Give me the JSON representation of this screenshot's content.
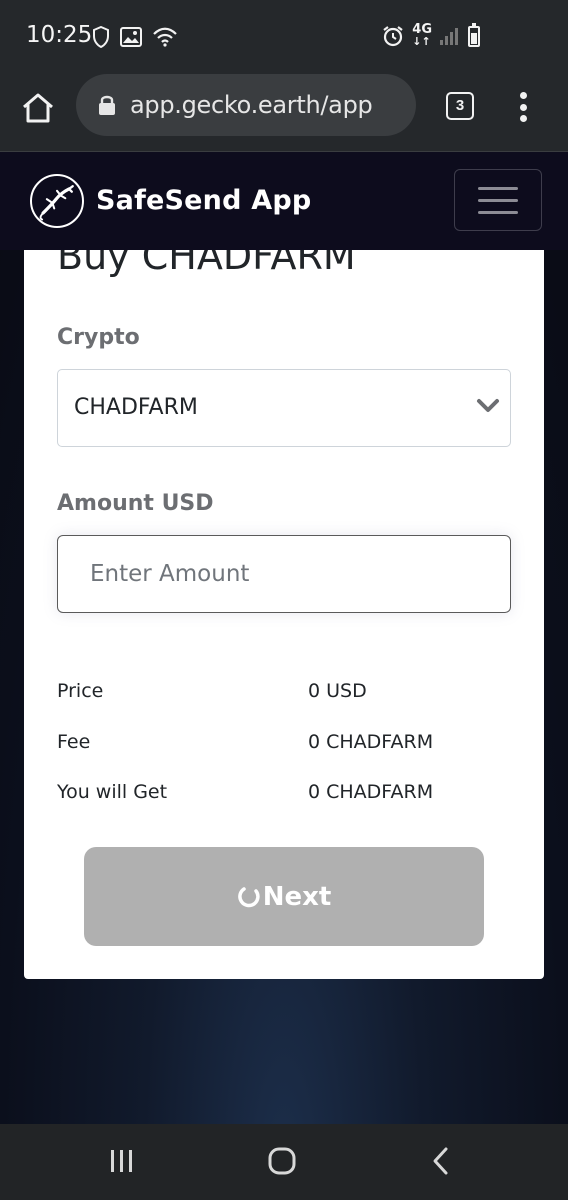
{
  "status_bar": {
    "time": "10:25",
    "network": "4G",
    "icons": [
      "shield-icon",
      "image-icon",
      "wifi-icon",
      "alarm-icon",
      "signal-icon",
      "battery-icon"
    ]
  },
  "browser": {
    "url": "app.gecko.earth/app",
    "tab_count": "3",
    "icons": [
      "home-icon",
      "lock-icon",
      "more-vert-icon"
    ]
  },
  "header": {
    "brand_name": "SafeSend App",
    "icons": [
      "gecko-logo-icon",
      "hamburger-menu-icon"
    ]
  },
  "form": {
    "title": "Buy CHADFARM",
    "crypto_label": "Crypto",
    "crypto_selected": "CHADFARM",
    "amount_label": "Amount USD",
    "amount_placeholder": "Enter Amount",
    "amount_value": "",
    "summary": [
      {
        "label": "Price",
        "value": "0 USD"
      },
      {
        "label": "Fee",
        "value": "0 CHADFARM"
      },
      {
        "label": "You will Get",
        "value": "0 CHADFARM"
      }
    ],
    "next_label": "Next",
    "colors": {
      "button_disabled": "#b0b0b0",
      "header_bg": "#0d0c1d",
      "label_gray": "#6c6e72"
    }
  },
  "nav": {
    "icons": [
      "recent-apps-icon",
      "home-nav-icon",
      "back-icon"
    ]
  }
}
